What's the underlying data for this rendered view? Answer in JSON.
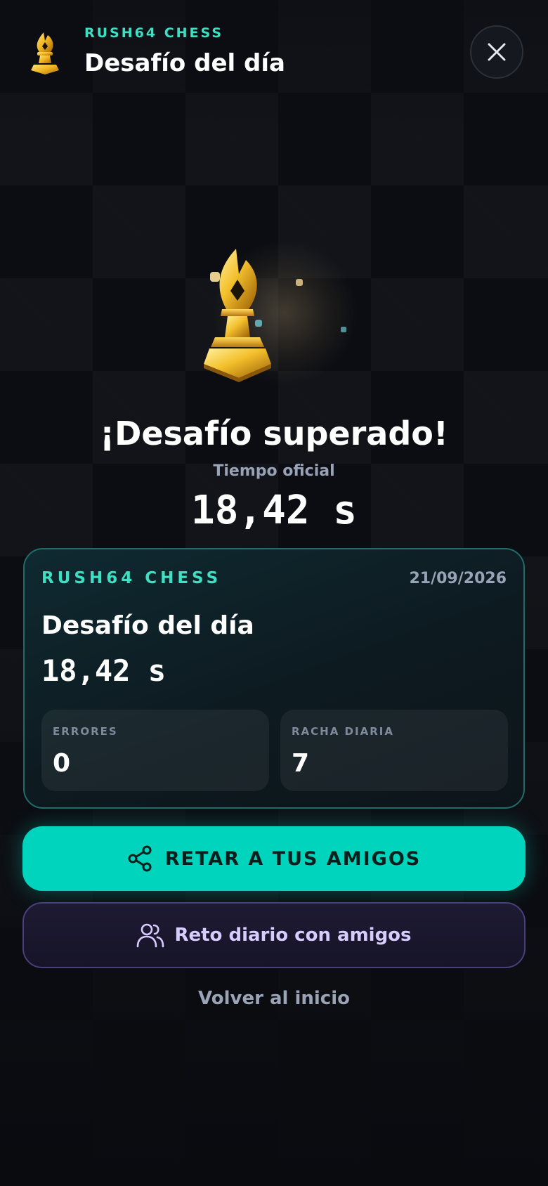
{
  "header": {
    "brand": "RUSH64 CHESS",
    "title": "Desafío del día",
    "logo_icon": "golden-bishop-icon",
    "close_icon": "close-icon"
  },
  "result": {
    "trophy_icon": "golden-bishop-trophy-icon",
    "heading": "¡Desafío superado!",
    "time_label": "Tiempo oficial",
    "time_value": "18,42 s"
  },
  "card": {
    "brand": "RUSH64 CHESS",
    "date": "21/09/2026",
    "title": "Desafío del día",
    "time": "18,42 s",
    "stats": [
      {
        "label": "ERRORES",
        "value": "0"
      },
      {
        "label": "RACHA DIARIA",
        "value": "7"
      }
    ]
  },
  "actions": {
    "challenge_label": "RETAR A TUS AMIGOS",
    "challenge_icon": "share-icon",
    "daily_friends_label": "Reto diario con amigos",
    "daily_friends_icon": "users-icon",
    "back_label": "Volver al inicio"
  },
  "colors": {
    "background": "#0b0d12",
    "accent": "#00d4bc",
    "brand_teal": "#3ee0c4",
    "gold": "#f2c230",
    "secondary_button_text": "#d8ccff"
  }
}
